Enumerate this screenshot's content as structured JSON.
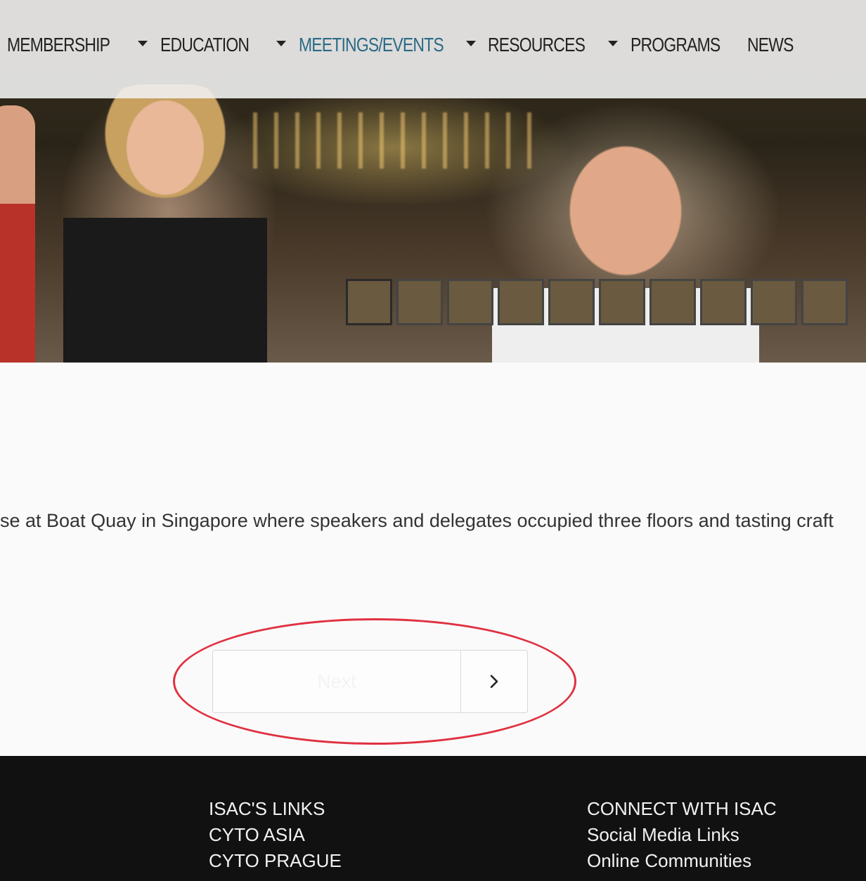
{
  "nav": {
    "items": [
      {
        "label": "MEMBERSHIP",
        "active": false,
        "has_caret": false
      },
      {
        "label": "EDUCATION",
        "active": false,
        "has_caret": true
      },
      {
        "label": "MEETINGS/EVENTS",
        "active": true,
        "has_caret": true
      },
      {
        "label": "RESOURCES",
        "active": false,
        "has_caret": true
      },
      {
        "label": "PROGRAMS",
        "active": false,
        "has_caret": true
      },
      {
        "label": "NEWS",
        "active": false,
        "has_caret": false
      }
    ],
    "active_color": "#2b6a85"
  },
  "gallery": {
    "thumbnail_count": 10
  },
  "content": {
    "caption": "se at Boat Quay in Singapore where speakers and delegates occupied three floors and tasting craft"
  },
  "pager": {
    "next_label": "Next",
    "next_icon": "chevron-right-icon"
  },
  "footer": {
    "left_links": [
      "ISAC'S LINKS",
      "CYTO ASIA",
      "CYTO PRAGUE"
    ],
    "right_links": [
      "CONNECT WITH ISAC",
      "Social Media Links",
      "Online Communities"
    ]
  },
  "annotation": {
    "color": "#e03040"
  }
}
